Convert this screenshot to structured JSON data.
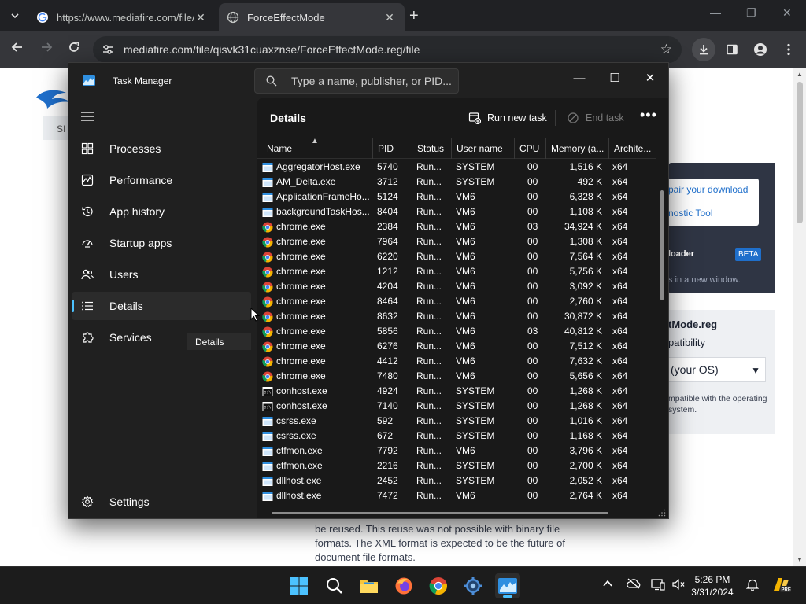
{
  "browser": {
    "tabs": [
      {
        "title": "https://www.mediafire.com/file/",
        "active": false
      },
      {
        "title": "ForceEffectMode",
        "active": true
      }
    ],
    "new_tab_label": "+",
    "window_controls": {
      "minimize": "—",
      "maximize": "❐",
      "close": "✕"
    },
    "url": "mediafire.com/file/qisvk31cuaxznse/ForceEffectMode.reg/file"
  },
  "webpage": {
    "signin_fragment": "SI",
    "repair_link": "pair your download",
    "diagnostic_link": "nostic Tool",
    "downloader_label": "loader",
    "beta_badge": "BETA",
    "new_window_text": "s in a new window.",
    "file_name": "tMode.reg",
    "compat_label": "patibility",
    "os_select": "(your OS)",
    "compat_note": "mpatible with the operating system.",
    "paragraph": "be reused. This reuse was not possible with binary file formats. The XML format is expected to be the future of document file formats."
  },
  "task_manager": {
    "title": "Task Manager",
    "search_placeholder": "Type a name, publisher, or PID...",
    "window_controls": {
      "minimize": "—",
      "maximize": "☐",
      "close": "✕"
    },
    "nav": [
      {
        "label": "Processes",
        "icon": "processes-grid-icon"
      },
      {
        "label": "Performance",
        "icon": "performance-chart-icon"
      },
      {
        "label": "App history",
        "icon": "history-clock-icon"
      },
      {
        "label": "Startup apps",
        "icon": "startup-gauge-icon"
      },
      {
        "label": "Users",
        "icon": "users-icon"
      },
      {
        "label": "Details",
        "icon": "details-list-icon",
        "selected": true
      },
      {
        "label": "Services",
        "icon": "services-puzzle-icon"
      }
    ],
    "settings_label": "Settings",
    "tooltip": "Details",
    "section_title": "Details",
    "run_new_task": "Run new task",
    "end_task": "End task",
    "more": "•••",
    "columns": [
      "Name",
      "PID",
      "Status",
      "User name",
      "CPU",
      "Memory (a...",
      "Archite..."
    ],
    "rows": [
      {
        "name": "AggregatorHost.exe",
        "icon": "app",
        "pid": "5740",
        "status": "Run...",
        "user": "SYSTEM",
        "cpu": "00",
        "mem": "1,516 K",
        "arch": "x64"
      },
      {
        "name": "AM_Delta.exe",
        "icon": "app",
        "pid": "3712",
        "status": "Run...",
        "user": "SYSTEM",
        "cpu": "00",
        "mem": "492 K",
        "arch": "x64"
      },
      {
        "name": "ApplicationFrameHo...",
        "icon": "app",
        "pid": "5124",
        "status": "Run...",
        "user": "VM6",
        "cpu": "00",
        "mem": "6,328 K",
        "arch": "x64"
      },
      {
        "name": "backgroundTaskHos...",
        "icon": "app",
        "pid": "8404",
        "status": "Run...",
        "user": "VM6",
        "cpu": "00",
        "mem": "1,108 K",
        "arch": "x64"
      },
      {
        "name": "chrome.exe",
        "icon": "chrome",
        "pid": "2384",
        "status": "Run...",
        "user": "VM6",
        "cpu": "03",
        "mem": "34,924 K",
        "arch": "x64"
      },
      {
        "name": "chrome.exe",
        "icon": "chrome",
        "pid": "7964",
        "status": "Run...",
        "user": "VM6",
        "cpu": "00",
        "mem": "1,308 K",
        "arch": "x64"
      },
      {
        "name": "chrome.exe",
        "icon": "chrome",
        "pid": "6220",
        "status": "Run...",
        "user": "VM6",
        "cpu": "00",
        "mem": "7,564 K",
        "arch": "x64"
      },
      {
        "name": "chrome.exe",
        "icon": "chrome",
        "pid": "1212",
        "status": "Run...",
        "user": "VM6",
        "cpu": "00",
        "mem": "5,756 K",
        "arch": "x64"
      },
      {
        "name": "chrome.exe",
        "icon": "chrome",
        "pid": "4204",
        "status": "Run...",
        "user": "VM6",
        "cpu": "00",
        "mem": "3,092 K",
        "arch": "x64"
      },
      {
        "name": "chrome.exe",
        "icon": "chrome",
        "pid": "8464",
        "status": "Run...",
        "user": "VM6",
        "cpu": "00",
        "mem": "2,760 K",
        "arch": "x64"
      },
      {
        "name": "chrome.exe",
        "icon": "chrome",
        "pid": "8632",
        "status": "Run...",
        "user": "VM6",
        "cpu": "00",
        "mem": "30,872 K",
        "arch": "x64"
      },
      {
        "name": "chrome.exe",
        "icon": "chrome",
        "pid": "5856",
        "status": "Run...",
        "user": "VM6",
        "cpu": "03",
        "mem": "40,812 K",
        "arch": "x64"
      },
      {
        "name": "chrome.exe",
        "icon": "chrome",
        "pid": "6276",
        "status": "Run...",
        "user": "VM6",
        "cpu": "00",
        "mem": "7,512 K",
        "arch": "x64"
      },
      {
        "name": "chrome.exe",
        "icon": "chrome",
        "pid": "4412",
        "status": "Run...",
        "user": "VM6",
        "cpu": "00",
        "mem": "7,632 K",
        "arch": "x64"
      },
      {
        "name": "chrome.exe",
        "icon": "chrome",
        "pid": "7480",
        "status": "Run...",
        "user": "VM6",
        "cpu": "00",
        "mem": "5,656 K",
        "arch": "x64"
      },
      {
        "name": "conhost.exe",
        "icon": "console",
        "pid": "4924",
        "status": "Run...",
        "user": "SYSTEM",
        "cpu": "00",
        "mem": "1,268 K",
        "arch": "x64"
      },
      {
        "name": "conhost.exe",
        "icon": "console",
        "pid": "7140",
        "status": "Run...",
        "user": "SYSTEM",
        "cpu": "00",
        "mem": "1,268 K",
        "arch": "x64"
      },
      {
        "name": "csrss.exe",
        "icon": "app",
        "pid": "592",
        "status": "Run...",
        "user": "SYSTEM",
        "cpu": "00",
        "mem": "1,016 K",
        "arch": "x64"
      },
      {
        "name": "csrss.exe",
        "icon": "app",
        "pid": "672",
        "status": "Run...",
        "user": "SYSTEM",
        "cpu": "00",
        "mem": "1,168 K",
        "arch": "x64"
      },
      {
        "name": "ctfmon.exe",
        "icon": "app",
        "pid": "7792",
        "status": "Run...",
        "user": "VM6",
        "cpu": "00",
        "mem": "3,796 K",
        "arch": "x64"
      },
      {
        "name": "ctfmon.exe",
        "icon": "app",
        "pid": "2216",
        "status": "Run...",
        "user": "SYSTEM",
        "cpu": "00",
        "mem": "2,700 K",
        "arch": "x64"
      },
      {
        "name": "dllhost.exe",
        "icon": "app",
        "pid": "2452",
        "status": "Run...",
        "user": "SYSTEM",
        "cpu": "00",
        "mem": "2,052 K",
        "arch": "x64"
      },
      {
        "name": "dllhost.exe",
        "icon": "app",
        "pid": "7472",
        "status": "Run...",
        "user": "VM6",
        "cpu": "00",
        "mem": "2,764 K",
        "arch": "x64"
      }
    ]
  },
  "taskbar": {
    "apps": [
      "windows-start-icon",
      "search-icon",
      "file-explorer-icon",
      "firefox-icon",
      "chrome-icon",
      "settings-gear-icon",
      "task-manager-icon"
    ],
    "time": "5:26 PM",
    "date": "3/31/2024"
  },
  "colors": {
    "accent": "#4cc2ff",
    "tm_background": "#202020",
    "tm_content": "#191919",
    "chrome_dark": "#202124"
  }
}
